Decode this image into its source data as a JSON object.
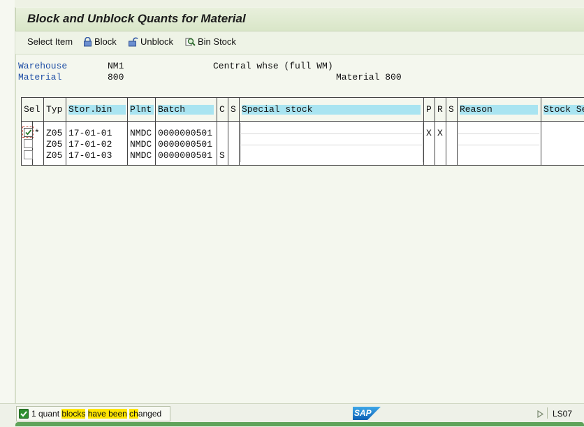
{
  "title": "Block and Unblock Quants for Material",
  "toolbar": {
    "select_item": "Select Item",
    "block": "Block",
    "unblock": "Unblock",
    "bin_stock": "Bin Stock"
  },
  "header": {
    "warehouse_label": "Warehouse",
    "warehouse_value": "NM1",
    "warehouse_desc": "Central whse (full WM)",
    "material_label": "Material",
    "material_value": "800",
    "material_desc": "Material 800"
  },
  "table": {
    "columns": [
      "Sel",
      "Typ",
      "Stor.bin",
      "Plnt",
      "Batch",
      "C",
      "S",
      "Special stock",
      "P",
      "R",
      "S",
      "Reason",
      "Stock Se"
    ],
    "rows": [
      {
        "checked": true,
        "marker": "*",
        "typ": "Z05",
        "bin": "17-01-01",
        "plnt": "NMDC",
        "batch": "0000000501",
        "c": "",
        "p": "X",
        "r": "X"
      },
      {
        "checked": false,
        "marker": "",
        "typ": "Z05",
        "bin": "17-01-02",
        "plnt": "NMDC",
        "batch": "0000000501",
        "c": "",
        "p": "",
        "r": ""
      },
      {
        "checked": false,
        "marker": "",
        "typ": "Z05",
        "bin": "17-01-03",
        "plnt": "NMDC",
        "batch": "0000000501",
        "c": "S",
        "p": "",
        "r": ""
      }
    ]
  },
  "status": {
    "message_parts": [
      "1 quant ",
      "blocks",
      " ",
      "have been",
      " ",
      "ch",
      "anged"
    ],
    "logo": "SAP",
    "system": "LS07"
  },
  "colors": {
    "header_highlight": "#a9e4f1",
    "label_blue": "#1f4fa6",
    "highlight_yellow": "#ffe600"
  }
}
